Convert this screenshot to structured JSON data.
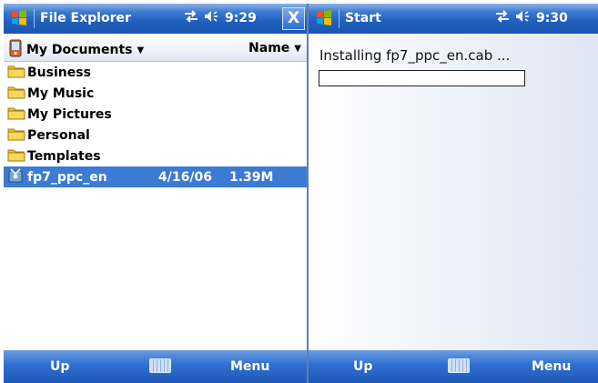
{
  "left": {
    "title": "File Explorer",
    "time": "9:29",
    "close_label": "X",
    "folder": "My Documents",
    "sort": "Name",
    "files": [
      {
        "name": "Business",
        "type": "folder",
        "date": "",
        "size": ""
      },
      {
        "name": "My Music",
        "type": "folder",
        "date": "",
        "size": ""
      },
      {
        "name": "My Pictures",
        "type": "folder",
        "date": "",
        "size": ""
      },
      {
        "name": "Personal",
        "type": "folder",
        "date": "",
        "size": ""
      },
      {
        "name": "Templates",
        "type": "folder",
        "date": "",
        "size": ""
      },
      {
        "name": "fp7_ppc_en",
        "type": "cab",
        "date": "4/16/06",
        "size": "1.39M",
        "selected": true
      }
    ],
    "softkeys": {
      "left": "Up",
      "right": "Menu"
    }
  },
  "right": {
    "title": "Start",
    "time": "9:30",
    "message": "Installing fp7_ppc_en.cab ...",
    "progress": 0,
    "softkeys": {
      "left": "Up",
      "right": "Menu"
    }
  },
  "colors": {
    "titlebar": "#1f5fbd",
    "selection": "#3b7bd4",
    "folder": "#f2c233"
  },
  "icons": [
    "windows-flag-icon",
    "connectivity-icon",
    "speaker-icon",
    "folder-icon",
    "cab-file-icon",
    "document-device-icon",
    "keyboard-icon"
  ]
}
